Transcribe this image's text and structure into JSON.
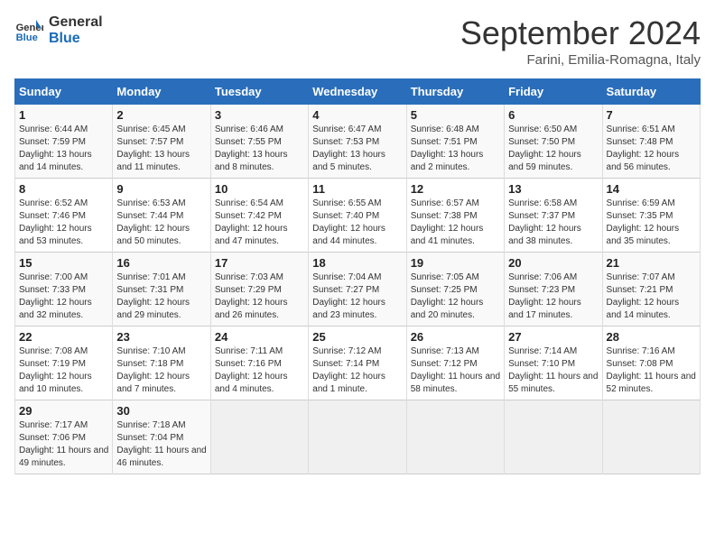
{
  "logo": {
    "line1": "General",
    "line2": "Blue"
  },
  "title": "September 2024",
  "location": "Farini, Emilia-Romagna, Italy",
  "weekdays": [
    "Sunday",
    "Monday",
    "Tuesday",
    "Wednesday",
    "Thursday",
    "Friday",
    "Saturday"
  ],
  "weeks": [
    [
      {
        "day": "1",
        "sunrise": "Sunrise: 6:44 AM",
        "sunset": "Sunset: 7:59 PM",
        "daylight": "Daylight: 13 hours and 14 minutes."
      },
      {
        "day": "2",
        "sunrise": "Sunrise: 6:45 AM",
        "sunset": "Sunset: 7:57 PM",
        "daylight": "Daylight: 13 hours and 11 minutes."
      },
      {
        "day": "3",
        "sunrise": "Sunrise: 6:46 AM",
        "sunset": "Sunset: 7:55 PM",
        "daylight": "Daylight: 13 hours and 8 minutes."
      },
      {
        "day": "4",
        "sunrise": "Sunrise: 6:47 AM",
        "sunset": "Sunset: 7:53 PM",
        "daylight": "Daylight: 13 hours and 5 minutes."
      },
      {
        "day": "5",
        "sunrise": "Sunrise: 6:48 AM",
        "sunset": "Sunset: 7:51 PM",
        "daylight": "Daylight: 13 hours and 2 minutes."
      },
      {
        "day": "6",
        "sunrise": "Sunrise: 6:50 AM",
        "sunset": "Sunset: 7:50 PM",
        "daylight": "Daylight: 12 hours and 59 minutes."
      },
      {
        "day": "7",
        "sunrise": "Sunrise: 6:51 AM",
        "sunset": "Sunset: 7:48 PM",
        "daylight": "Daylight: 12 hours and 56 minutes."
      }
    ],
    [
      {
        "day": "8",
        "sunrise": "Sunrise: 6:52 AM",
        "sunset": "Sunset: 7:46 PM",
        "daylight": "Daylight: 12 hours and 53 minutes."
      },
      {
        "day": "9",
        "sunrise": "Sunrise: 6:53 AM",
        "sunset": "Sunset: 7:44 PM",
        "daylight": "Daylight: 12 hours and 50 minutes."
      },
      {
        "day": "10",
        "sunrise": "Sunrise: 6:54 AM",
        "sunset": "Sunset: 7:42 PM",
        "daylight": "Daylight: 12 hours and 47 minutes."
      },
      {
        "day": "11",
        "sunrise": "Sunrise: 6:55 AM",
        "sunset": "Sunset: 7:40 PM",
        "daylight": "Daylight: 12 hours and 44 minutes."
      },
      {
        "day": "12",
        "sunrise": "Sunrise: 6:57 AM",
        "sunset": "Sunset: 7:38 PM",
        "daylight": "Daylight: 12 hours and 41 minutes."
      },
      {
        "day": "13",
        "sunrise": "Sunrise: 6:58 AM",
        "sunset": "Sunset: 7:37 PM",
        "daylight": "Daylight: 12 hours and 38 minutes."
      },
      {
        "day": "14",
        "sunrise": "Sunrise: 6:59 AM",
        "sunset": "Sunset: 7:35 PM",
        "daylight": "Daylight: 12 hours and 35 minutes."
      }
    ],
    [
      {
        "day": "15",
        "sunrise": "Sunrise: 7:00 AM",
        "sunset": "Sunset: 7:33 PM",
        "daylight": "Daylight: 12 hours and 32 minutes."
      },
      {
        "day": "16",
        "sunrise": "Sunrise: 7:01 AM",
        "sunset": "Sunset: 7:31 PM",
        "daylight": "Daylight: 12 hours and 29 minutes."
      },
      {
        "day": "17",
        "sunrise": "Sunrise: 7:03 AM",
        "sunset": "Sunset: 7:29 PM",
        "daylight": "Daylight: 12 hours and 26 minutes."
      },
      {
        "day": "18",
        "sunrise": "Sunrise: 7:04 AM",
        "sunset": "Sunset: 7:27 PM",
        "daylight": "Daylight: 12 hours and 23 minutes."
      },
      {
        "day": "19",
        "sunrise": "Sunrise: 7:05 AM",
        "sunset": "Sunset: 7:25 PM",
        "daylight": "Daylight: 12 hours and 20 minutes."
      },
      {
        "day": "20",
        "sunrise": "Sunrise: 7:06 AM",
        "sunset": "Sunset: 7:23 PM",
        "daylight": "Daylight: 12 hours and 17 minutes."
      },
      {
        "day": "21",
        "sunrise": "Sunrise: 7:07 AM",
        "sunset": "Sunset: 7:21 PM",
        "daylight": "Daylight: 12 hours and 14 minutes."
      }
    ],
    [
      {
        "day": "22",
        "sunrise": "Sunrise: 7:08 AM",
        "sunset": "Sunset: 7:19 PM",
        "daylight": "Daylight: 12 hours and 10 minutes."
      },
      {
        "day": "23",
        "sunrise": "Sunrise: 7:10 AM",
        "sunset": "Sunset: 7:18 PM",
        "daylight": "Daylight: 12 hours and 7 minutes."
      },
      {
        "day": "24",
        "sunrise": "Sunrise: 7:11 AM",
        "sunset": "Sunset: 7:16 PM",
        "daylight": "Daylight: 12 hours and 4 minutes."
      },
      {
        "day": "25",
        "sunrise": "Sunrise: 7:12 AM",
        "sunset": "Sunset: 7:14 PM",
        "daylight": "Daylight: 12 hours and 1 minute."
      },
      {
        "day": "26",
        "sunrise": "Sunrise: 7:13 AM",
        "sunset": "Sunset: 7:12 PM",
        "daylight": "Daylight: 11 hours and 58 minutes."
      },
      {
        "day": "27",
        "sunrise": "Sunrise: 7:14 AM",
        "sunset": "Sunset: 7:10 PM",
        "daylight": "Daylight: 11 hours and 55 minutes."
      },
      {
        "day": "28",
        "sunrise": "Sunrise: 7:16 AM",
        "sunset": "Sunset: 7:08 PM",
        "daylight": "Daylight: 11 hours and 52 minutes."
      }
    ],
    [
      {
        "day": "29",
        "sunrise": "Sunrise: 7:17 AM",
        "sunset": "Sunset: 7:06 PM",
        "daylight": "Daylight: 11 hours and 49 minutes."
      },
      {
        "day": "30",
        "sunrise": "Sunrise: 7:18 AM",
        "sunset": "Sunset: 7:04 PM",
        "daylight": "Daylight: 11 hours and 46 minutes."
      },
      null,
      null,
      null,
      null,
      null
    ]
  ]
}
